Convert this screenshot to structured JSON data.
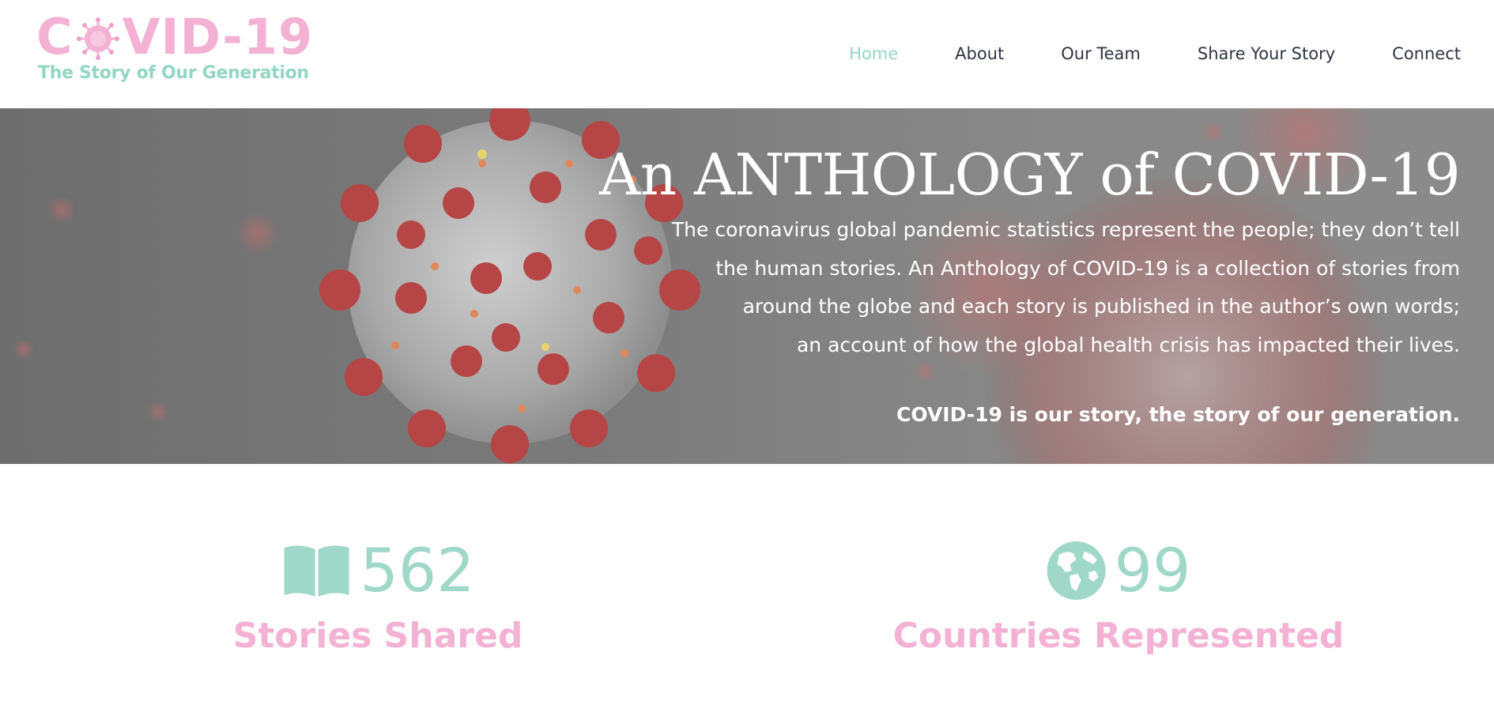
{
  "header": {
    "logo": {
      "title_prefix": "C",
      "title_suffix": "VID-19",
      "tagline": "The Story of Our Generation"
    },
    "nav": [
      {
        "label": "Home",
        "active": true
      },
      {
        "label": "About",
        "active": false
      },
      {
        "label": "Our Team",
        "active": false
      },
      {
        "label": "Share Your Story",
        "active": false
      },
      {
        "label": "Connect",
        "active": false
      }
    ]
  },
  "hero": {
    "title": "An ANTHOLOGY of COVID-19",
    "paragraph_lines": [
      "The coronavirus global pandemic statistics represent the people; they don’t tell",
      "the human stories. An Anthology of COVID-19 is a collection of stories from",
      "around the globe and each story is published in the author’s own words;",
      "an account of how the global health crisis has impacted their lives."
    ],
    "tagline": "COVID-19 is our story, the story of our generation."
  },
  "stats": [
    {
      "icon": "open-book-icon",
      "number": "562",
      "label": "Stories Shared"
    },
    {
      "icon": "globe-icon",
      "number": "99",
      "label": "Countries Represented"
    }
  ],
  "colors": {
    "pink": "#f3b2d4",
    "mint": "#9fd8c8",
    "nav_text": "#2f3440",
    "hero_bg": "#7b7b7b"
  }
}
